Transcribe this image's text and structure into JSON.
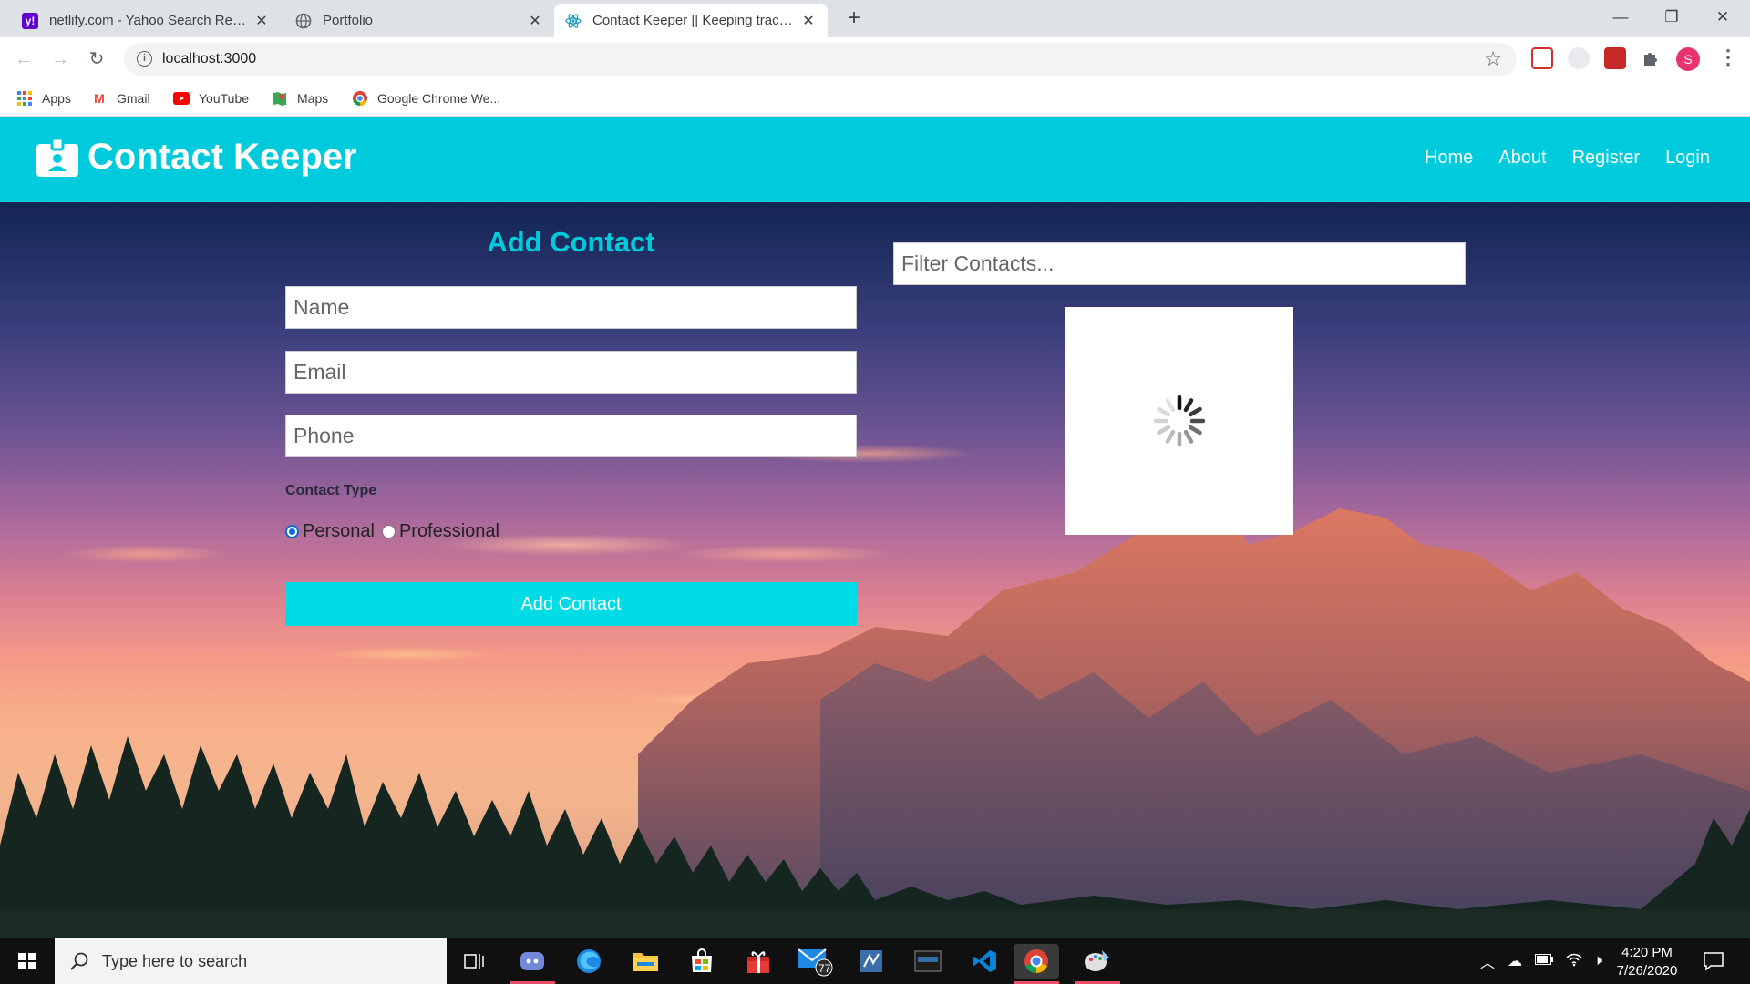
{
  "browser": {
    "tabs": [
      {
        "title": "netlify.com - Yahoo Search Results",
        "favicon": "yahoo-icon",
        "active": false
      },
      {
        "title": "Portfolio",
        "favicon": "globe-icon",
        "active": false
      },
      {
        "title": "Contact Keeper || Keeping track of contacts",
        "favicon": "react-icon",
        "active": true
      }
    ],
    "url": "localhost:3000",
    "bookmarks": [
      "Apps",
      "Gmail",
      "YouTube",
      "Maps",
      "Google Chrome We..."
    ],
    "profile_initial": "S"
  },
  "app": {
    "brand": "Contact Keeper",
    "brand_icon": "id-badge-icon",
    "nav": [
      "Home",
      "About",
      "Register",
      "Login"
    ],
    "form": {
      "title": "Add Contact",
      "name_placeholder": "Name",
      "email_placeholder": "Email",
      "phone_placeholder": "Phone",
      "contact_type_label": "Contact Type",
      "options": [
        "Personal",
        "Professional"
      ],
      "selected": "Personal",
      "submit_label": "Add Contact"
    },
    "filter_placeholder": "Filter Contacts...",
    "loading": true
  },
  "taskbar": {
    "search_placeholder": "Type here to search",
    "mail_badge": "77",
    "time": "4:20 PM",
    "date": "7/26/2020"
  },
  "colors": {
    "accent": "#00cbdc",
    "button": "#00dce6",
    "tabbar": "#dee1e6"
  }
}
